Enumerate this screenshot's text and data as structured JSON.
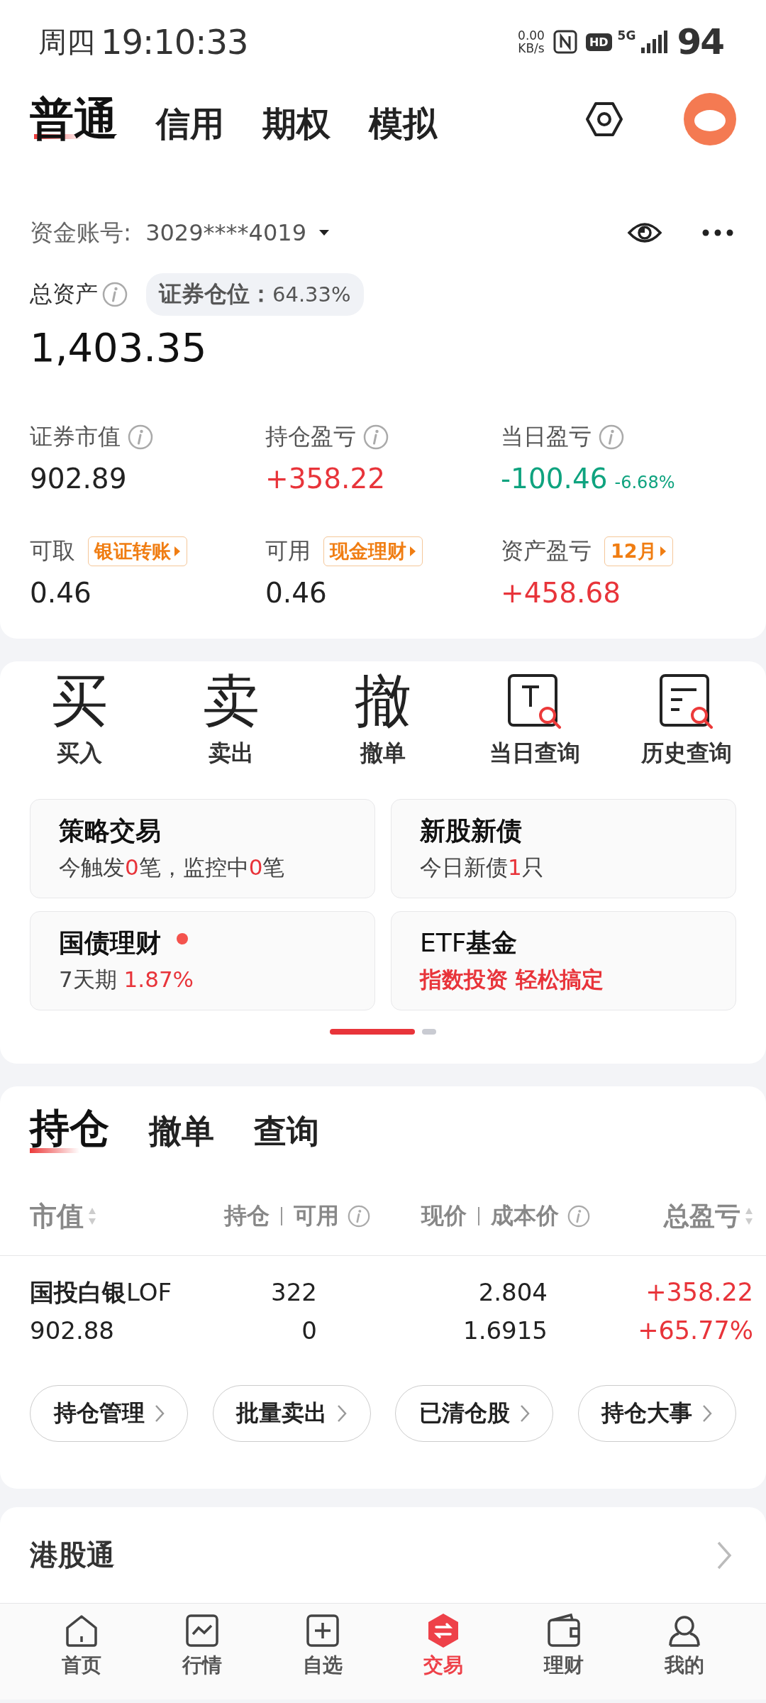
{
  "status_bar": {
    "day": "周四",
    "time": "19:10:33",
    "net_speed": "0.00",
    "net_unit": "KB/s",
    "hd": "HD",
    "network": "5G",
    "battery": "94"
  },
  "account_tabs": [
    {
      "label": "普通",
      "selected": true
    },
    {
      "label": "信用",
      "selected": false
    },
    {
      "label": "期权",
      "selected": false
    },
    {
      "label": "模拟",
      "selected": false
    }
  ],
  "account": {
    "label": "资金账号:",
    "number": "3029****4019"
  },
  "total_assets": {
    "label": "总资产",
    "position_label": "证券仓位：",
    "position_value": "64.33%",
    "value": "1,403.35"
  },
  "metrics": [
    {
      "label": "证券市值",
      "value": "902.89",
      "color": "#222222"
    },
    {
      "label": "持仓盈亏",
      "value": "+358.22",
      "color": "#e8343a"
    },
    {
      "label": "当日盈亏",
      "value": "-100.46",
      "color": "#0fa37f",
      "sub": "-6.68%"
    }
  ],
  "balances": [
    {
      "label": "可取",
      "tag": "银证转账",
      "value": "0.46",
      "color": "#222222"
    },
    {
      "label": "可用",
      "tag": "现金理财",
      "value": "0.46",
      "color": "#222222"
    },
    {
      "label": "资产盈亏",
      "tag": "12月",
      "value": "+458.68",
      "color": "#e8343a"
    }
  ],
  "actions": [
    {
      "label": "买入",
      "kind": "glyph",
      "glyph": "买"
    },
    {
      "label": "卖出",
      "kind": "glyph",
      "glyph": "卖"
    },
    {
      "label": "撤单",
      "kind": "glyph",
      "glyph": "撤"
    },
    {
      "label": "当日查询",
      "kind": "today-query"
    },
    {
      "label": "历史查询",
      "kind": "history-query"
    }
  ],
  "tiles": [
    {
      "title": "策略交易",
      "bold": true,
      "dot": false,
      "subtitle_bold": false,
      "subtitle": [
        {
          "text": "今触发",
          "accent": false
        },
        {
          "text": "0",
          "accent": true
        },
        {
          "text": "笔，监控中",
          "accent": false
        },
        {
          "text": "0",
          "accent": true
        },
        {
          "text": "笔",
          "accent": false
        }
      ]
    },
    {
      "title": "新股新债",
      "bold": true,
      "dot": false,
      "subtitle_bold": false,
      "subtitle": [
        {
          "text": "今日新债",
          "accent": false
        },
        {
          "text": "1",
          "accent": true
        },
        {
          "text": "只",
          "accent": false
        }
      ]
    },
    {
      "title": "国债理财",
      "bold": true,
      "dot": true,
      "subtitle_bold": false,
      "subtitle": [
        {
          "text": "7天期",
          "accent": false
        },
        {
          "text": " 1.87%",
          "accent": true
        }
      ]
    },
    {
      "title": "ETF**基金**",
      "bold": false,
      "dot": false,
      "subtitle_bold": true,
      "subtitle": [
        {
          "text": "指数投资 轻松搞定",
          "accent": true
        }
      ]
    }
  ],
  "pager": [
    {
      "selected": true
    },
    {
      "selected": false
    }
  ],
  "holdings_tabs": [
    {
      "label": "持仓",
      "selected": true
    },
    {
      "label": "撤单",
      "selected": false
    },
    {
      "label": "查询",
      "selected": false
    }
  ],
  "columns": [
    {
      "labels": [
        "市值"
      ],
      "sort": true,
      "info": false
    },
    {
      "labels": [
        "持仓",
        "可用"
      ],
      "sort": false,
      "info": true
    },
    {
      "labels": [
        "现价",
        "成本价"
      ],
      "sort": false,
      "info": true
    },
    {
      "labels": [
        "总盈亏"
      ],
      "sort": true,
      "info": false
    }
  ],
  "rows": [
    {
      "name": "国投白银",
      "name_suffix": "LOF",
      "market_value": "902.88",
      "holding": "322",
      "available": "0",
      "price": "2.804",
      "cost": "1.6915",
      "pnl": "+358.22",
      "pnl_pct": "+65.77%",
      "color": "#e8343a"
    }
  ],
  "holding_buttons": [
    "持仓管理",
    "批量卖出",
    "已清仓股",
    "持仓大事"
  ],
  "hk_connect": {
    "label": "港股通"
  },
  "nav": [
    {
      "label": "首页",
      "kind": "home",
      "selected": false
    },
    {
      "label": "行情",
      "kind": "market",
      "selected": false
    },
    {
      "label": "自选",
      "kind": "watchlist",
      "selected": false
    },
    {
      "label": "交易",
      "kind": "trade",
      "selected": true
    },
    {
      "label": "理财",
      "kind": "wallet",
      "selected": false
    },
    {
      "label": "我的",
      "kind": "profile",
      "selected": false
    }
  ]
}
